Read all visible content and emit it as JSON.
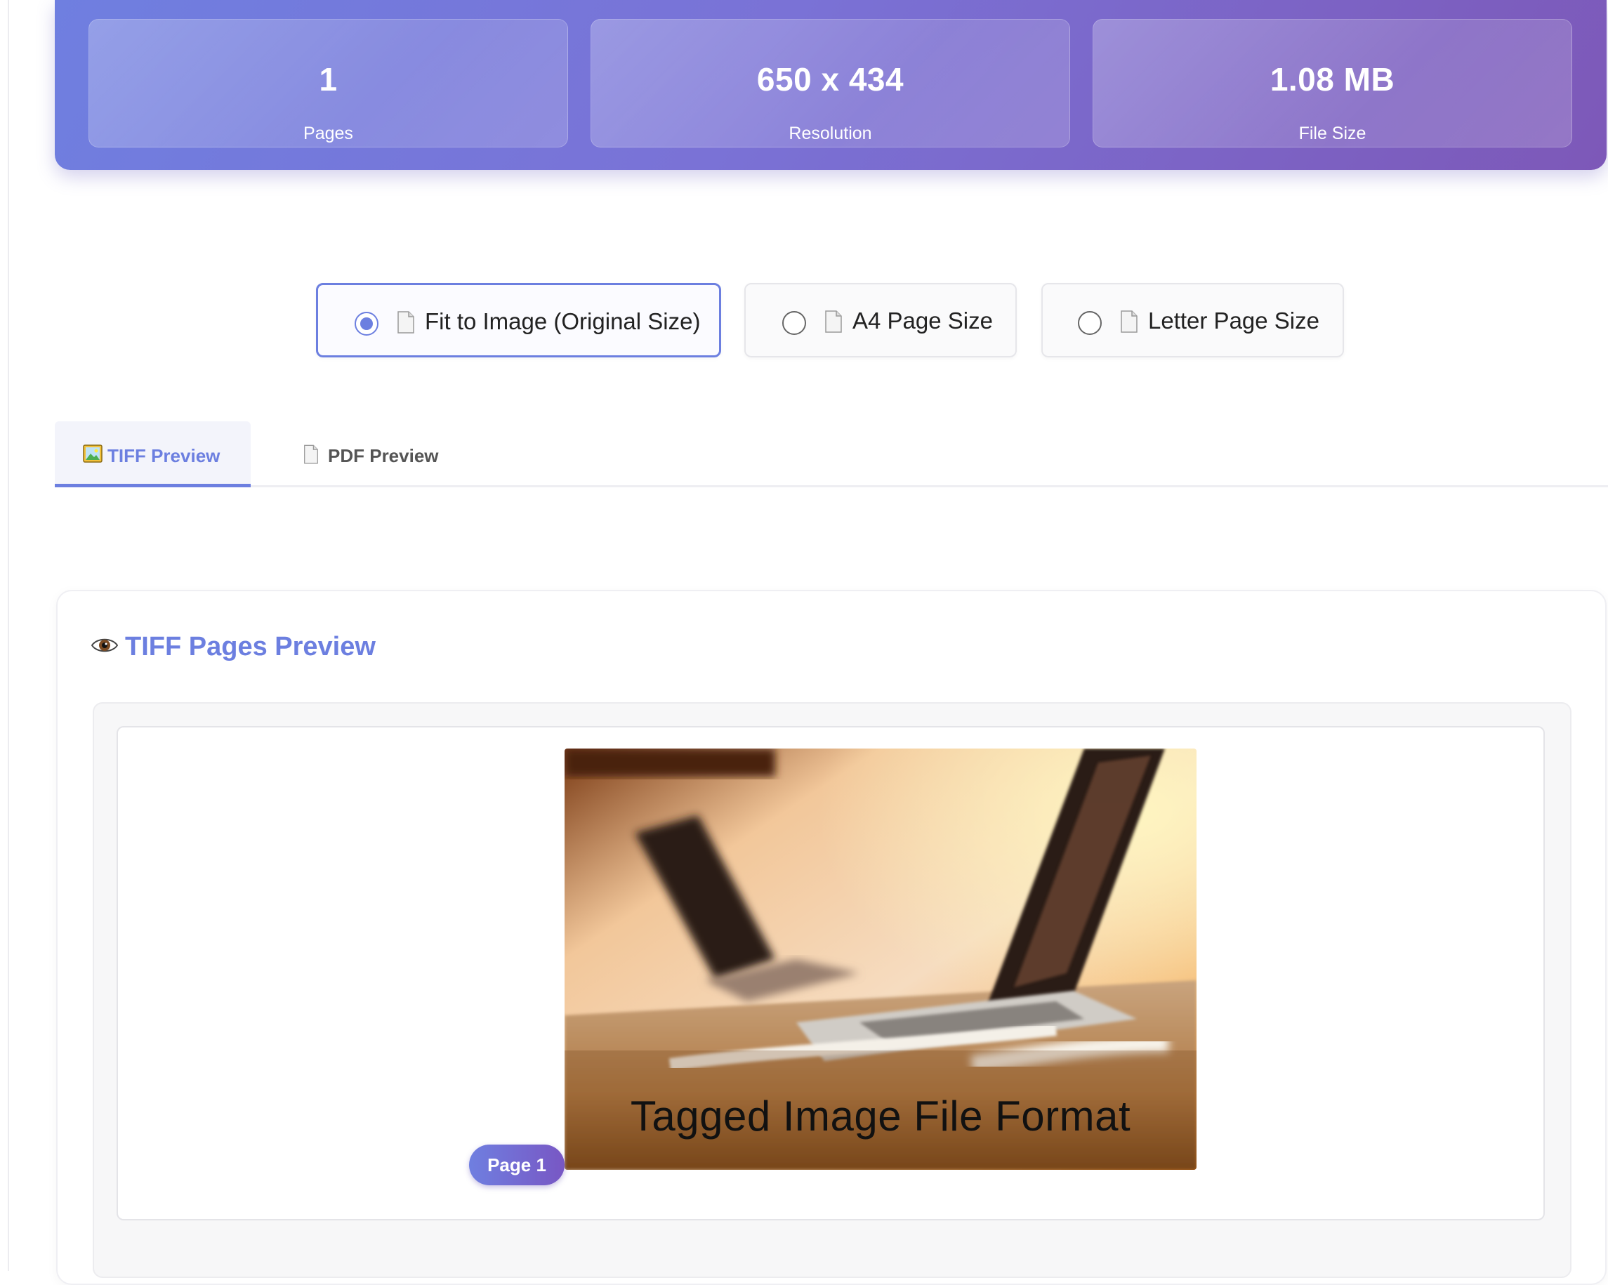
{
  "stats": [
    {
      "value": "1",
      "label": "Pages"
    },
    {
      "value": "650 x 434",
      "label": "Resolution"
    },
    {
      "value": "1.08 MB",
      "label": "File Size"
    }
  ],
  "page_size_options": [
    {
      "label": "Fit to Image (Original Size)",
      "selected": true,
      "icon": "document-icon"
    },
    {
      "label": "A4 Page Size",
      "selected": false,
      "icon": "document-icon"
    },
    {
      "label": "Letter Page Size",
      "selected": false,
      "icon": "document-icon"
    }
  ],
  "tabs": [
    {
      "label": "TIFF Preview",
      "icon": "picture-icon",
      "active": true
    },
    {
      "label": "PDF Preview",
      "icon": "document-icon",
      "active": false
    }
  ],
  "preview": {
    "title": "TIFF Pages Preview",
    "title_icon": "eye-icon",
    "pages": [
      {
        "badge": "Page 1",
        "image_caption": "Tagged Image File Format"
      }
    ]
  },
  "colors": {
    "accent": "#6c7fe0",
    "banner_start": "#6f7fe0",
    "banner_end": "#7d58b8"
  }
}
